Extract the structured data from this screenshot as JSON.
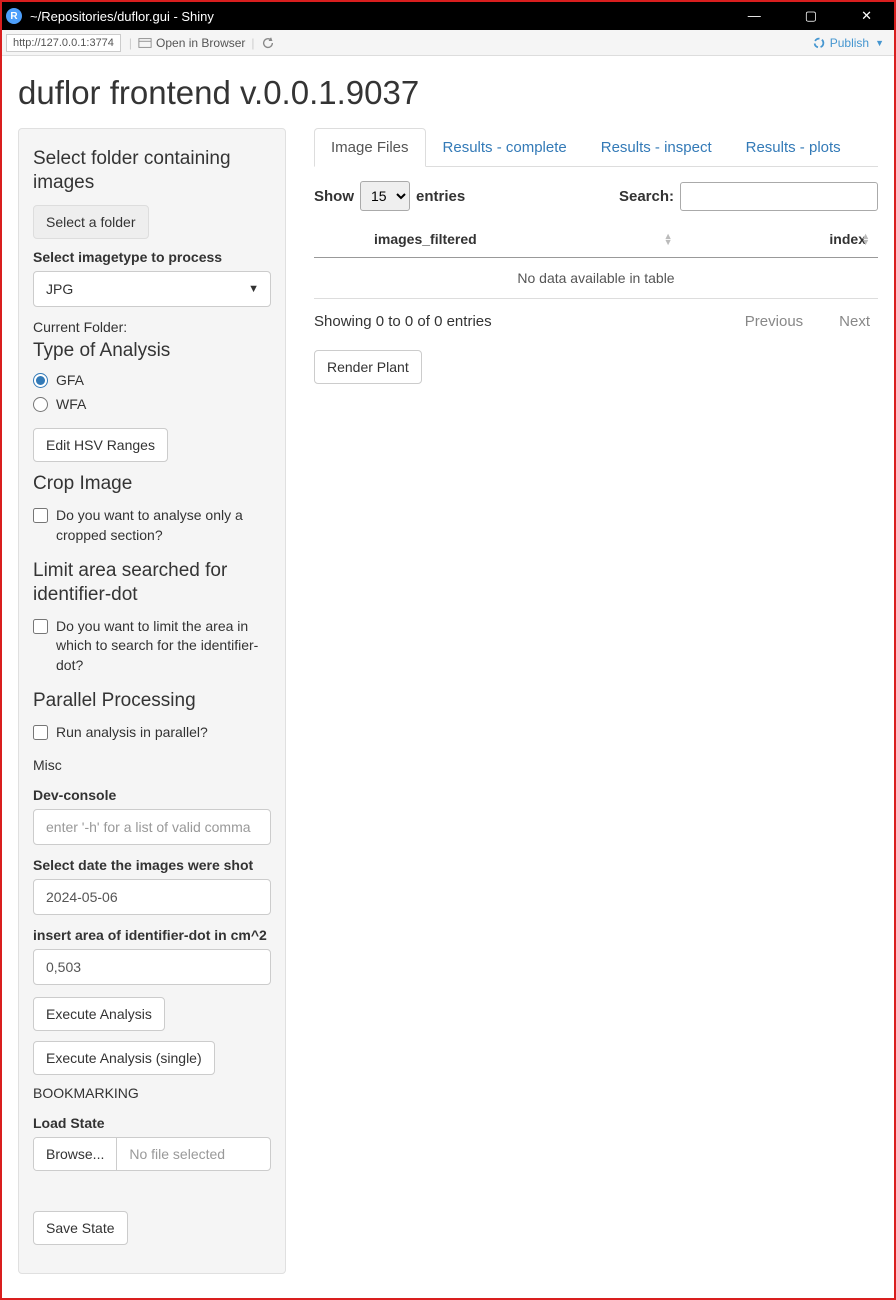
{
  "window": {
    "title": "~/Repositories/duflor.gui - Shiny",
    "icon_letter": "R"
  },
  "toolbar": {
    "url": "http://127.0.0.1:3774",
    "open_browser": "Open in Browser",
    "publish": "Publish"
  },
  "page": {
    "title": "duflor frontend v.0.0.1.9037"
  },
  "sidebar": {
    "folder_heading": "Select folder containing images",
    "select_folder_btn": "Select a folder",
    "imagetype_label": "Select imagetype to process",
    "imagetype_value": "JPG",
    "current_folder_label": "Current Folder:",
    "analysis_heading": "Type of Analysis",
    "radio_gfa": "GFA",
    "radio_wfa": "WFA",
    "edit_hsv_btn": "Edit HSV Ranges",
    "crop_heading": "Crop Image",
    "crop_check": "Do you want to analyse only a cropped section?",
    "limit_heading": "Limit area searched for identifier-dot",
    "limit_check": "Do you want to limit the area in which to search for the identifier-dot?",
    "parallel_heading": "Parallel Processing",
    "parallel_check": "Run analysis in parallel?",
    "misc_label": "Misc",
    "devconsole_label": "Dev-console",
    "devconsole_placeholder": "enter '-h' for a list of valid comma",
    "date_label": "Select date the images were shot",
    "date_value": "2024-05-06",
    "area_label": "insert area of identifier-dot in cm^2",
    "area_value": "0,503",
    "exec_btn": "Execute Analysis",
    "exec_single_btn": "Execute Analysis (single)",
    "bookmarking_label": "BOOKMARKING",
    "load_state_label": "Load State",
    "browse_btn": "Browse...",
    "no_file": "No file selected",
    "save_state_btn": "Save State"
  },
  "main": {
    "tabs": [
      "Image Files",
      "Results - complete",
      "Results - inspect",
      "Results - plots"
    ],
    "show_label": "Show",
    "entries_value": "15",
    "entries_label": "entries",
    "search_label": "Search:",
    "columns": {
      "images": "images_filtered",
      "index": "index"
    },
    "empty_msg": "No data available in table",
    "info": "Showing 0 to 0 of 0 entries",
    "previous": "Previous",
    "next": "Next",
    "render_btn": "Render Plant"
  }
}
